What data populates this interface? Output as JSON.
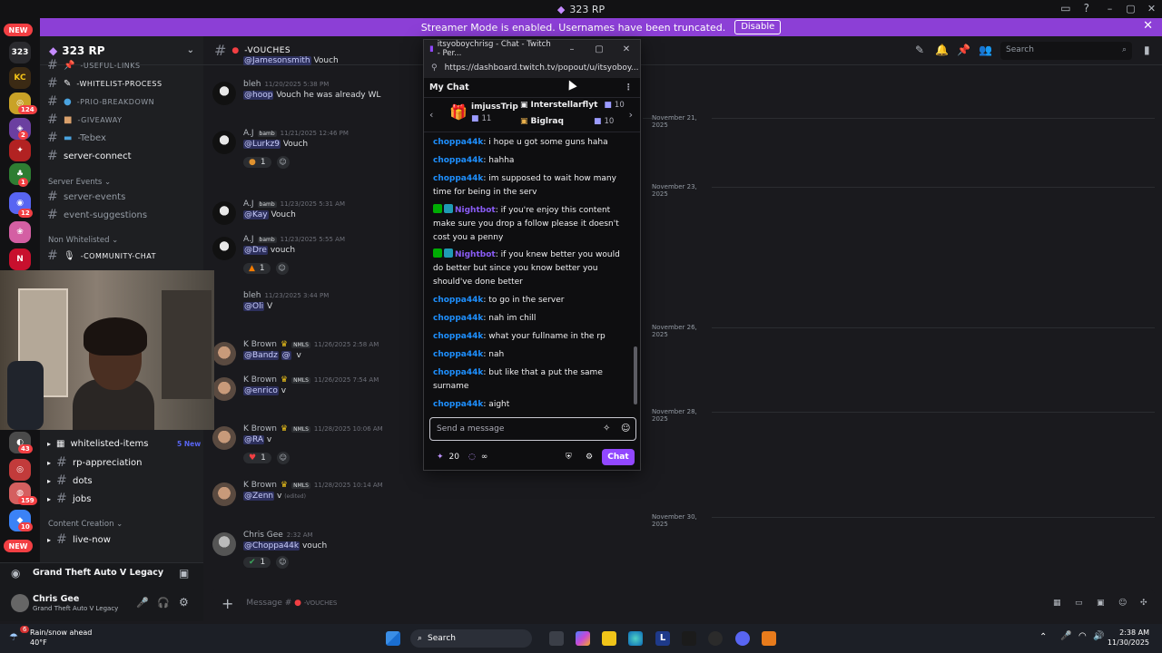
{
  "window": {
    "title": "323 RP"
  },
  "banner": {
    "text": "Streamer Mode is enabled. Usernames have been truncated.",
    "button": "Disable"
  },
  "servers": {
    "new_top": "NEW",
    "new_bottom": "NEW",
    "counts": [
      "124",
      "2",
      "1",
      "12",
      "43",
      "159",
      "10"
    ]
  },
  "sidebar": {
    "server_name": "323 RP",
    "channels": {
      "useful_links": "-USEFUL-LINKS",
      "whitelist_process": "-WHITELIST-PROCESS",
      "prio_breakdown": "-PRIO-BREAKDOWN",
      "giveaway": "-GIVEAWAY",
      "tebex": "-Tebex",
      "server_connect": "server-connect",
      "server_events_cat": "Server Events",
      "server_events": "server-events",
      "event_suggestions": "event-suggestions",
      "non_whitelisted_cat": "Non Whitelisted",
      "community_chat": "-COMMUNITY-CHAT",
      "whitelisted_items": "whitelisted-items",
      "whitelisted_items_badge": "5 New",
      "rp_appreciation": "rp-appreciation",
      "dots": "dots",
      "jobs": "jobs",
      "content_creation_cat": "Content Creation",
      "live_now": "live-now"
    },
    "voice_activity": "Grand Theft Auto V Legacy",
    "user": {
      "name": "Chris Gee",
      "status": "Grand Theft Auto V Legacy"
    }
  },
  "channel_header": {
    "name": "-VOUCHES",
    "search_placeholder": "Search"
  },
  "messages": [
    {
      "author": "",
      "time": "",
      "text": "Vouch",
      "mention": "@Jamesonsmith"
    },
    {
      "author": "bleh",
      "time": "11/20/2025 5:38 PM",
      "mention": "@hoop",
      "text": "Vouch he was already WL"
    },
    {
      "author": "A.J",
      "tag": "bamb",
      "time": "11/21/2025 12:46 PM",
      "mention": "@Lurkz9",
      "text": "Vouch",
      "reaction_count": "1"
    },
    {
      "author": "A.J",
      "tag": "bamb",
      "time": "11/23/2025 5:31 AM",
      "mention": "@Kay",
      "text": "Vouch"
    },
    {
      "author": "A.J",
      "tag": "bamb",
      "time": "11/23/2025 5:55 AM",
      "mention": "@Dre",
      "text": "vouch",
      "reaction_count": "1"
    },
    {
      "author": "bleh",
      "time": "11/23/2025 3:44 PM",
      "mention": "@Oli",
      "text": "V"
    },
    {
      "author": "K Brown",
      "tag": "NMLS",
      "time": "11/26/2025 2:58 AM",
      "mention": "@Bandz",
      "mention2": "@",
      "text": "v"
    },
    {
      "author": "K Brown",
      "tag": "NMLS",
      "time": "11/26/2025 7:54 AM",
      "mention": "@enrico",
      "text": "v"
    },
    {
      "author": "K Brown",
      "tag": "NMLS",
      "time": "11/28/2025 10:06 AM",
      "mention": "@RA",
      "text": "v",
      "reaction_count": "1"
    },
    {
      "author": "K Brown",
      "tag": "NMLS",
      "time": "11/28/2025 10:14 AM",
      "mention": "@Zenn",
      "text": "v",
      "edited": "(edited)"
    },
    {
      "author": "Chris Gee",
      "time": "2:32 AM",
      "mention": "@Choppa44k",
      "text": "vouch",
      "reaction_count": "1"
    }
  ],
  "dates": [
    "November 21, 2025",
    "November 23, 2025",
    "November 26, 2025",
    "November 28, 2025",
    "November 30, 2025"
  ],
  "composer": {
    "placeholder": "Message #",
    "channel": "-VOUCHES"
  },
  "twitch": {
    "window_title": "itsyoboychrisg - Chat - Twitch - Per...",
    "url": "https://dashboard.twitch.tv/popout/u/itsyoboy...",
    "header": "My Chat",
    "gifters": [
      {
        "name": "imjussTrip",
        "count": "11"
      },
      {
        "name": "Interstellarflyt",
        "count": "10"
      },
      {
        "name": "Biglraq",
        "count": "10"
      }
    ],
    "lines": [
      {
        "user": "choppa44k",
        "text": ": i hope u got some guns haha"
      },
      {
        "user": "choppa44k",
        "text": ": hahha"
      },
      {
        "user": "choppa44k",
        "text": ": im supposed to wait how many time for being in the serv"
      },
      {
        "user": "Nightbot",
        "text": ": if you're enjoy this content make sure you drop a follow please it doesn't cost you a penny"
      },
      {
        "user": "Nightbot",
        "text": ": if you knew better you would do better but since you know better you should've done better"
      },
      {
        "user": "choppa44k",
        "text": ": to go in the server"
      },
      {
        "user": "choppa44k",
        "text": ": nah im chill"
      },
      {
        "user": "choppa44k",
        "text": ": what your fullname in the rp"
      },
      {
        "user": "choppa44k",
        "text": ": nah"
      },
      {
        "user": "choppa44k",
        "text": ": but like that a put the same surname"
      },
      {
        "user": "choppa44k",
        "text": ": aight"
      }
    ],
    "input_placeholder": "Send a message",
    "points": "20",
    "infinity": "∞",
    "chat_button": "Chat"
  },
  "taskbar": {
    "weather_title": "Rain/snow ahead",
    "weather_temp": "40°F",
    "weather_badge": "6",
    "search": "Search",
    "time": "2:38 AM",
    "date": "11/30/2025"
  }
}
